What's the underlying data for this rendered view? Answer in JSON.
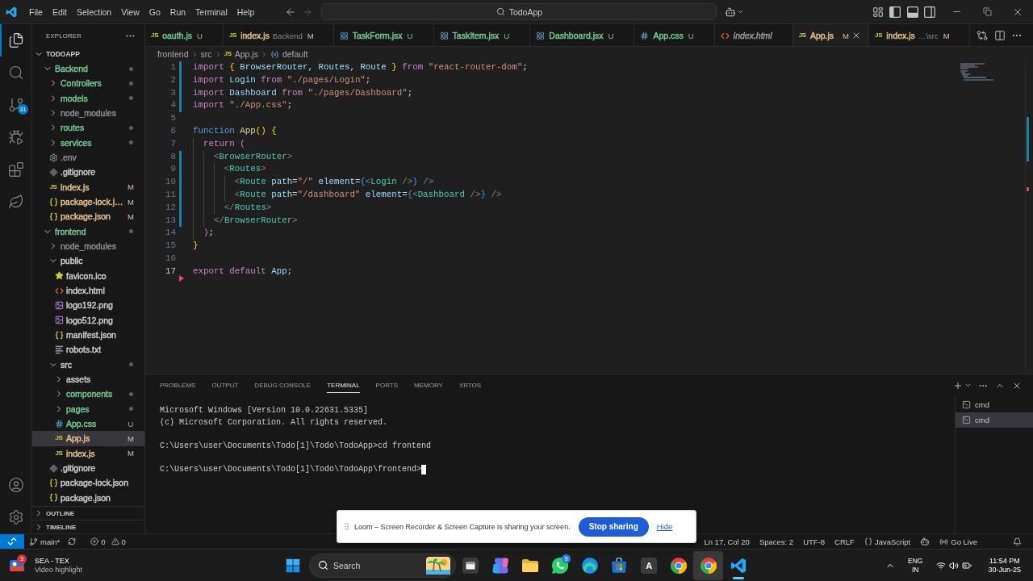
{
  "title_bar": {
    "menu": [
      "File",
      "Edit",
      "Selection",
      "View",
      "Go",
      "Run",
      "Terminal",
      "Help"
    ],
    "nav": [
      {
        "kind": "back",
        "disabled": false
      },
      {
        "kind": "forward",
        "disabled": true
      }
    ],
    "command_center": "TodoApp",
    "layout_toggles": [
      {
        "kind": "primary-sidebar",
        "on": true
      },
      {
        "kind": "panel",
        "on": true
      },
      {
        "kind": "secondary-sidebar",
        "on": false
      }
    ]
  },
  "activity_bar": {
    "items": [
      {
        "kind": "explorer",
        "selected": true
      },
      {
        "kind": "search",
        "selected": false
      },
      {
        "kind": "source-control",
        "selected": false,
        "badge": "31"
      },
      {
        "kind": "run-debug",
        "selected": false
      },
      {
        "kind": "extensions",
        "selected": false
      },
      {
        "kind": "leaf",
        "selected": false
      }
    ],
    "bottom": [
      {
        "kind": "account"
      },
      {
        "kind": "settings"
      }
    ]
  },
  "sidebar": {
    "title": "EXPLORER",
    "root": {
      "label": "TODOAPP",
      "expanded": true
    },
    "tree": [
      {
        "name": "Backend",
        "kind": "folder",
        "color": "#73c991",
        "expanded": true,
        "dot": true,
        "selected": false,
        "children": [
          {
            "name": "Controllers",
            "kind": "folder",
            "color": "#73c991",
            "expanded": false,
            "dot": true,
            "selected": false
          },
          {
            "name": "models",
            "kind": "folder",
            "color": "#73c991",
            "expanded": false,
            "dot": true,
            "selected": false
          },
          {
            "name": "node_modules",
            "kind": "folder",
            "color": "#8c8c8c",
            "expanded": false,
            "dot": false,
            "selected": false
          },
          {
            "name": "routes",
            "kind": "folder",
            "color": "#73c991",
            "expanded": false,
            "dot": true,
            "selected": false
          },
          {
            "name": "services",
            "kind": "folder",
            "color": "#73c991",
            "expanded": false,
            "dot": true,
            "selected": false
          },
          {
            "name": ".env",
            "kind": "env",
            "color": "#8c8c8c",
            "selected": false
          },
          {
            "name": ".gitignore",
            "kind": "git",
            "color": "#cccccc",
            "selected": false
          },
          {
            "name": "index.js",
            "kind": "js",
            "glyph": "JS",
            "color": "#e2c08d",
            "badge": "M",
            "selected": false
          },
          {
            "name": "package-lock.j…",
            "kind": "json",
            "color": "#e2c08d",
            "badge": "M",
            "selected": false
          },
          {
            "name": "package.json",
            "kind": "json",
            "color": "#e2c08d",
            "badge": "M",
            "selected": false
          }
        ]
      },
      {
        "name": "frontend",
        "kind": "folder",
        "color": "#73c991",
        "expanded": true,
        "dot": true,
        "selected": false,
        "children": [
          {
            "name": "node_modules",
            "kind": "folder",
            "color": "#8c8c8c",
            "expanded": false,
            "dot": false,
            "selected": false
          },
          {
            "name": "public",
            "kind": "folder",
            "color": "#cccccc",
            "expanded": true,
            "dot": false,
            "selected": false,
            "children": [
              {
                "name": "favicon.ico",
                "kind": "favicon",
                "color": "#cccccc",
                "selected": false
              },
              {
                "name": "index.html",
                "kind": "html",
                "color": "#cccccc",
                "selected": false
              },
              {
                "name": "logo192.png",
                "kind": "image",
                "color": "#cccccc",
                "selected": false
              },
              {
                "name": "logo512.png",
                "kind": "image",
                "color": "#cccccc",
                "selected": false
              },
              {
                "name": "manifest.json",
                "kind": "json",
                "color": "#cccccc",
                "selected": false
              },
              {
                "name": "robots.txt",
                "kind": "text",
                "color": "#cccccc",
                "selected": false
              }
            ]
          },
          {
            "name": "src",
            "kind": "folder",
            "color": "#cccccc",
            "expanded": true,
            "dot": true,
            "selected": false,
            "children": [
              {
                "name": "assets",
                "kind": "folder",
                "color": "#cccccc",
                "expanded": false,
                "dot": false,
                "selected": false
              },
              {
                "name": "components",
                "kind": "folder",
                "color": "#73c991",
                "expanded": false,
                "dot": true,
                "selected": false
              },
              {
                "name": "pages",
                "kind": "folder",
                "color": "#73c991",
                "expanded": false,
                "dot": true,
                "selected": false
              },
              {
                "name": "App.css",
                "kind": "css",
                "color": "#73c991",
                "badge": "U",
                "selected": false
              },
              {
                "name": "App.js",
                "kind": "js",
                "glyph": "JS",
                "color": "#e2c08d",
                "badge": "M",
                "selected": true
              },
              {
                "name": "index.js",
                "kind": "js",
                "glyph": "JS",
                "color": "#e2c08d",
                "badge": "M",
                "selected": false
              }
            ]
          },
          {
            "name": ".gitignore",
            "kind": "git",
            "color": "#cccccc",
            "selected": false
          },
          {
            "name": "package-lock.json",
            "kind": "json",
            "color": "#cccccc",
            "selected": false
          },
          {
            "name": "package.json",
            "kind": "json",
            "color": "#cccccc",
            "selected": false
          }
        ]
      }
    ],
    "sections": [
      {
        "label": "OUTLINE",
        "expanded": false
      },
      {
        "label": "TIMELINE",
        "expanded": false
      }
    ]
  },
  "tabs": [
    {
      "label": "oauth.js",
      "kind": "js",
      "glyph": "JS",
      "color": "#73c991",
      "badge": "U",
      "preview": false,
      "selected": false
    },
    {
      "label": "index.js",
      "description": "Backend",
      "kind": "js",
      "glyph": "JS",
      "color": "#e2c08d",
      "badge": "M",
      "preview": false,
      "selected": false
    },
    {
      "label": "TaskForm.jsx",
      "kind": "react",
      "color": "#73c991",
      "badge": "U",
      "preview": false,
      "selected": false
    },
    {
      "label": "TaskItem.jsx",
      "kind": "react",
      "color": "#73c991",
      "badge": "U",
      "preview": false,
      "selected": false
    },
    {
      "label": "Dashboard.jsx",
      "kind": "react",
      "color": "#73c991",
      "badge": "U",
      "preview": false,
      "selected": false
    },
    {
      "label": "App.css",
      "kind": "css",
      "color": "#73c991",
      "badge": "U",
      "preview": false,
      "selected": false
    },
    {
      "label": "index.html",
      "kind": "html",
      "color": "#9d9d9d",
      "preview": true,
      "selected": false
    },
    {
      "label": "App.js",
      "kind": "js",
      "glyph": "JS",
      "color": "#e2c08d",
      "badge": "M",
      "preview": false,
      "selected": true
    },
    {
      "label": "index.js",
      "description": "…\\src",
      "kind": "js",
      "glyph": "JS",
      "color": "#e2c08d",
      "badge": "M",
      "preview": false,
      "selected": false
    }
  ],
  "breadcrumb": [
    {
      "label": "frontend",
      "kind": "folder"
    },
    {
      "label": "src",
      "kind": "folder"
    },
    {
      "label": "App.js",
      "kind": "js",
      "glyph": "JS"
    },
    {
      "label": "default",
      "kind": "symbol"
    }
  ],
  "editor": {
    "lines": [
      {
        "number": "1",
        "current": false,
        "modified": true,
        "deleted": false,
        "tokens": [
          {
            "kind": "keyword",
            "text": "import "
          },
          {
            "kind": "bracket1",
            "text": "{ "
          },
          {
            "kind": "variable",
            "text": "BrowserRouter"
          },
          {
            "kind": "plain",
            "text": ", "
          },
          {
            "kind": "variable",
            "text": "Routes"
          },
          {
            "kind": "plain",
            "text": ", "
          },
          {
            "kind": "variable",
            "text": "Route "
          },
          {
            "kind": "bracket1",
            "text": "} "
          },
          {
            "kind": "keyword",
            "text": "from "
          },
          {
            "kind": "string",
            "text": "\"react-router-dom\""
          },
          {
            "kind": "plain",
            "text": ";"
          }
        ]
      },
      {
        "number": "2",
        "current": false,
        "modified": true,
        "deleted": false,
        "tokens": [
          {
            "kind": "keyword",
            "text": "import "
          },
          {
            "kind": "variable",
            "text": "Login "
          },
          {
            "kind": "keyword",
            "text": "from "
          },
          {
            "kind": "string",
            "text": "\"./pages/Login\""
          },
          {
            "kind": "plain",
            "text": ";"
          }
        ]
      },
      {
        "number": "3",
        "current": false,
        "modified": true,
        "deleted": false,
        "tokens": [
          {
            "kind": "keyword",
            "text": "import "
          },
          {
            "kind": "variable",
            "text": "Dashboard "
          },
          {
            "kind": "keyword",
            "text": "from "
          },
          {
            "kind": "string",
            "text": "\"./pages/Dashboard\""
          },
          {
            "kind": "plain",
            "text": ";"
          }
        ]
      },
      {
        "number": "4",
        "current": false,
        "modified": true,
        "deleted": false,
        "tokens": [
          {
            "kind": "keyword",
            "text": "import "
          },
          {
            "kind": "string",
            "text": "\"./App.css\""
          },
          {
            "kind": "plain",
            "text": ";"
          }
        ]
      },
      {
        "number": "5",
        "current": false,
        "modified": false,
        "deleted": false
      },
      {
        "number": "6",
        "current": false,
        "modified": false,
        "deleted": false,
        "tokens": [
          {
            "kind": "storage",
            "text": "function "
          },
          {
            "kind": "function",
            "text": "App"
          },
          {
            "kind": "bracket1",
            "text": "() "
          },
          {
            "kind": "bracket1",
            "text": "{"
          }
        ]
      },
      {
        "number": "7",
        "current": false,
        "modified": false,
        "deleted": false,
        "tokens": [
          {
            "kind": "keyword",
            "text": "  return "
          },
          {
            "kind": "bracket2",
            "text": "("
          }
        ]
      },
      {
        "number": "8",
        "current": false,
        "modified": true,
        "deleted": false,
        "tokens": [
          {
            "kind": "punct",
            "text": "    <"
          },
          {
            "kind": "tag",
            "text": "BrowserRouter"
          },
          {
            "kind": "punct",
            "text": ">"
          }
        ]
      },
      {
        "number": "9",
        "current": false,
        "modified": true,
        "deleted": false,
        "tokens": [
          {
            "kind": "punct",
            "text": "      <"
          },
          {
            "kind": "tag",
            "text": "Routes"
          },
          {
            "kind": "punct",
            "text": ">"
          }
        ]
      },
      {
        "number": "10",
        "current": false,
        "modified": true,
        "deleted": false,
        "tokens": [
          {
            "kind": "punct",
            "text": "        <"
          },
          {
            "kind": "tag",
            "text": "Route "
          },
          {
            "kind": "attr",
            "text": "path"
          },
          {
            "kind": "plain",
            "text": "="
          },
          {
            "kind": "string",
            "text": "\"/\" "
          },
          {
            "kind": "attr",
            "text": "element"
          },
          {
            "kind": "plain",
            "text": "="
          },
          {
            "kind": "bracket3",
            "text": "{"
          },
          {
            "kind": "punct",
            "text": "<"
          },
          {
            "kind": "tag",
            "text": "Login "
          },
          {
            "kind": "punct",
            "text": "/>"
          },
          {
            "kind": "bracket3",
            "text": "} "
          },
          {
            "kind": "punct",
            "text": "/>"
          }
        ]
      },
      {
        "number": "11",
        "current": false,
        "modified": true,
        "deleted": false,
        "tokens": [
          {
            "kind": "punct",
            "text": "        <"
          },
          {
            "kind": "tag",
            "text": "Route "
          },
          {
            "kind": "attr",
            "text": "path"
          },
          {
            "kind": "plain",
            "text": "="
          },
          {
            "kind": "string",
            "text": "\"/dashboard\" "
          },
          {
            "kind": "attr",
            "text": "element"
          },
          {
            "kind": "plain",
            "text": "="
          },
          {
            "kind": "bracket3",
            "text": "{"
          },
          {
            "kind": "punct",
            "text": "<"
          },
          {
            "kind": "tag",
            "text": "Dashboard "
          },
          {
            "kind": "punct",
            "text": "/>"
          },
          {
            "kind": "bracket3",
            "text": "} "
          },
          {
            "kind": "punct",
            "text": "/>"
          }
        ]
      },
      {
        "number": "12",
        "current": false,
        "modified": true,
        "deleted": false,
        "tokens": [
          {
            "kind": "punct",
            "text": "      </"
          },
          {
            "kind": "tag",
            "text": "Routes"
          },
          {
            "kind": "punct",
            "text": ">"
          }
        ]
      },
      {
        "number": "13",
        "current": false,
        "modified": true,
        "deleted": false,
        "tokens": [
          {
            "kind": "punct",
            "text": "    </"
          },
          {
            "kind": "tag",
            "text": "BrowserRouter"
          },
          {
            "kind": "punct",
            "text": ">"
          }
        ]
      },
      {
        "number": "14",
        "current": false,
        "modified": false,
        "deleted": false,
        "tokens": [
          {
            "kind": "bracket2",
            "text": "  )"
          },
          {
            "kind": "plain",
            "text": ";"
          }
        ]
      },
      {
        "number": "15",
        "current": false,
        "modified": false,
        "deleted": false,
        "tokens": [
          {
            "kind": "bracket1",
            "text": "}"
          }
        ]
      },
      {
        "number": "16",
        "current": false,
        "modified": false,
        "deleted": false
      },
      {
        "number": "17",
        "current": true,
        "modified": false,
        "deleted": true,
        "tokens": [
          {
            "kind": "keyword",
            "text": "export default "
          },
          {
            "kind": "variable",
            "text": "App"
          },
          {
            "kind": "plain",
            "text": ";"
          }
        ]
      }
    ]
  },
  "panel": {
    "tabs": [
      {
        "label": "PROBLEMS",
        "selected": false
      },
      {
        "label": "OUTPUT",
        "selected": false
      },
      {
        "label": "DEBUG CONSOLE",
        "selected": false
      },
      {
        "label": "TERMINAL",
        "selected": true
      },
      {
        "label": "PORTS",
        "selected": false
      },
      {
        "label": "MEMORY",
        "selected": false
      },
      {
        "label": "XRTOS",
        "selected": false
      }
    ],
    "terminal": {
      "blocks": [
        [
          "Microsoft Windows [Version 10.0.22631.5335]",
          "(c) Microsoft Corporation. All rights reserved."
        ],
        [
          "C:\\Users\\user\\Documents\\Todo[1]\\Todo\\TodoApp>cd frontend"
        ],
        [
          "C:\\Users\\user\\Documents\\Todo[1]\\Todo\\TodoApp\\frontend>"
        ]
      ],
      "cursor": true
    },
    "sessions": [
      {
        "label": "cmd",
        "selected": false
      },
      {
        "label": "cmd",
        "selected": true
      }
    ]
  },
  "status_bar": {
    "branch": "main*",
    "errors": "0",
    "warnings": "0",
    "right": [
      {
        "kind": "text",
        "label": "Ln 17, Col 20"
      },
      {
        "kind": "text",
        "label": "Spaces: 2"
      },
      {
        "kind": "text",
        "label": "UTF-8"
      },
      {
        "kind": "text",
        "label": "CRLF"
      },
      {
        "kind": "language",
        "label": "JavaScript"
      },
      {
        "kind": "assistant"
      },
      {
        "kind": "live",
        "label": "Go Live"
      },
      {
        "kind": "bell"
      }
    ]
  },
  "notification": {
    "message": "Loom – Screen Recorder & Screen Capture is sharing your screen.",
    "action": "Stop sharing",
    "link": "Hide"
  },
  "taskbar": {
    "widget": {
      "badge": "3",
      "title": "SEA - TEX",
      "subtitle": "Video highlight"
    },
    "search": {
      "placeholder": "Search"
    },
    "apps": [
      {
        "kind": "dark-window",
        "selected": false,
        "highlighted": false
      },
      {
        "kind": "assistant",
        "selected": false,
        "highlighted": false
      },
      {
        "kind": "folder",
        "selected": false,
        "highlighted": false
      },
      {
        "kind": "chat",
        "selected": false,
        "highlighted": false,
        "badge": "5"
      },
      {
        "kind": "swirl-browser",
        "selected": false,
        "highlighted": false
      },
      {
        "kind": "store",
        "selected": false,
        "highlighted": false
      },
      {
        "kind": "letter",
        "glyph": "A",
        "selected": false,
        "highlighted": false
      },
      {
        "kind": "round-browser",
        "selected": false,
        "highlighted": false
      },
      {
        "kind": "round-browser",
        "selected": false,
        "highlighted": true
      },
      {
        "kind": "code-editor",
        "selected": true,
        "highlighted": false
      }
    ],
    "tray": {
      "language": "ENG",
      "region": "IN",
      "time": "11:54 PM",
      "date": "30-Jun-25"
    }
  }
}
